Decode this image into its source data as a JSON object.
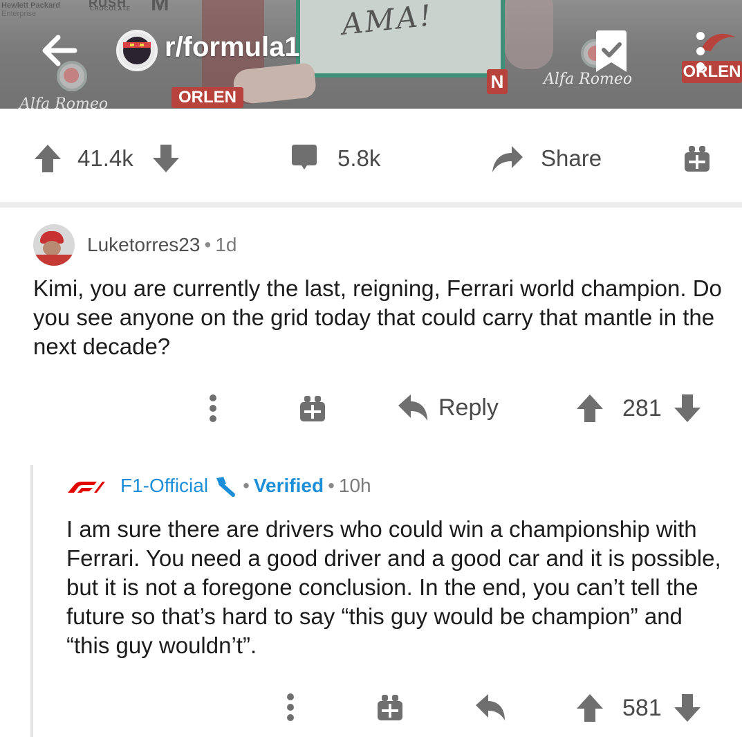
{
  "banner": {
    "sponsor_hp_1": "Hewlett Packard",
    "sponsor_hp_2": "Enterprise",
    "sponsor_rush": "RUSH",
    "sponsor_rush_sub": "CHOCOLATE",
    "sponsor_m": "M",
    "board_text": "AMA!",
    "orlen_1": "ORLEN",
    "orlen_2": "ORLEN",
    "n_box": "N",
    "alfa_romeo_1": "Alfa Romeo",
    "alfa_romeo_2": "Alfa Romeo"
  },
  "header": {
    "subreddit": "r/formula1",
    "icons": {
      "back": "arrow-left-icon",
      "save": "bookmark-check-icon",
      "more": "more-vertical-icon"
    }
  },
  "post_actions": {
    "upvotes": "41.4k",
    "comments": "5.8k",
    "share_label": "Share",
    "icons": {
      "up": "upvote-arrow-icon",
      "down": "downvote-arrow-icon",
      "comments": "comment-bubble-icon",
      "share": "share-arrow-icon",
      "award": "gift-icon"
    }
  },
  "comments": [
    {
      "author": "Luketorres23",
      "time": "1d",
      "body": "Kimi, you are currently the last, reigning, Ferrari world champion. Do you see anyone on the grid today that could carry that mantle in the next decade?",
      "reply_label": "Reply",
      "score": "281"
    },
    {
      "author": "F1-Official",
      "flair": "Verified",
      "time": "10h",
      "body": "I am sure there are drivers who could win a championship with Ferrari. You need a good driver and a good car and it is possible, but it is not a foregone conclusion. In the end, you can’t tell the future so that’s hard to say “this guy would be champion” and “this guy wouldn’t”.",
      "score": "581"
    }
  ],
  "colors": {
    "accent_blue": "#1d8fd8",
    "icon_gray": "#6f6f6f",
    "text_gray": "#4a4a4a",
    "orlen_red": "#b8433c",
    "board_green": "#3f8f79"
  }
}
